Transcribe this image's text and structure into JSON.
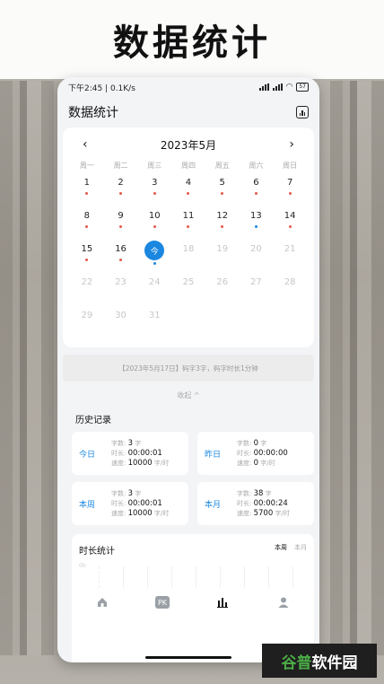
{
  "banner_title": "数据统计",
  "status": {
    "time": "下午2:45 | 0.1K/s",
    "battery": "57"
  },
  "header": {
    "title": "数据统计",
    "icon": "bar-chart-icon"
  },
  "calendar": {
    "month": "2023年5月",
    "prev_icon": "chevron-left-icon",
    "next_icon": "chevron-right-icon",
    "weekdays": [
      "周一",
      "周二",
      "周三",
      "周四",
      "周五",
      "周六",
      "周日"
    ],
    "today_label": "今",
    "days": [
      {
        "d": "1",
        "dot": "red"
      },
      {
        "d": "2",
        "dot": "red"
      },
      {
        "d": "3",
        "dot": "red"
      },
      {
        "d": "4",
        "dot": "red"
      },
      {
        "d": "5",
        "dot": "red"
      },
      {
        "d": "6",
        "dot": "red"
      },
      {
        "d": "7",
        "dot": "red"
      },
      {
        "d": "8",
        "dot": "red"
      },
      {
        "d": "9",
        "dot": "red"
      },
      {
        "d": "10",
        "dot": "red"
      },
      {
        "d": "11",
        "dot": "red"
      },
      {
        "d": "12",
        "dot": "red"
      },
      {
        "d": "13",
        "dot": "blue"
      },
      {
        "d": "14",
        "dot": "red"
      },
      {
        "d": "15",
        "dot": "red"
      },
      {
        "d": "16",
        "dot": "red"
      },
      {
        "d": "17",
        "dot": "blue",
        "today": true
      },
      {
        "d": "18",
        "future": true
      },
      {
        "d": "19",
        "future": true
      },
      {
        "d": "20",
        "future": true
      },
      {
        "d": "21",
        "future": true
      },
      {
        "d": "22",
        "future": true
      },
      {
        "d": "23",
        "future": true
      },
      {
        "d": "24",
        "future": true
      },
      {
        "d": "25",
        "future": true
      },
      {
        "d": "26",
        "future": true
      },
      {
        "d": "27",
        "future": true
      },
      {
        "d": "28",
        "future": true
      },
      {
        "d": "29",
        "future": true
      },
      {
        "d": "30",
        "future": true
      },
      {
        "d": "31",
        "future": true
      }
    ],
    "dot_colors": {
      "red": "#e35a4b",
      "blue": "#1a87e0"
    },
    "summary": "【2023年5月17日】码字3字，码字时长1分钟",
    "collapse": "收起 ^"
  },
  "history": {
    "title": "历史记录",
    "labels": {
      "count": "字数:",
      "duration": "时长:",
      "speed": "速度:",
      "unit_count": "字",
      "unit_speed": "字/时"
    },
    "cards": [
      {
        "name": "今日",
        "count": "3",
        "duration": "00:00:01",
        "speed": "10000"
      },
      {
        "name": "昨日",
        "count": "0",
        "duration": "00:00:00",
        "speed": "0"
      },
      {
        "name": "本周",
        "count": "3",
        "duration": "00:00:01",
        "speed": "10000"
      },
      {
        "name": "本月",
        "count": "38",
        "duration": "00:00:24",
        "speed": "5700"
      }
    ]
  },
  "duration_stats": {
    "title": "时长统计",
    "tabs": [
      "本周",
      "本月"
    ],
    "axis_zero": "0h"
  },
  "nav": {
    "items": [
      {
        "icon": "home-icon"
      },
      {
        "icon": "pk-icon",
        "label": "PK"
      },
      {
        "icon": "stats-icon"
      },
      {
        "icon": "profile-icon"
      }
    ]
  },
  "watermark": {
    "part1": "谷普",
    "part2": "软件园"
  },
  "accent": "#1a87e0"
}
